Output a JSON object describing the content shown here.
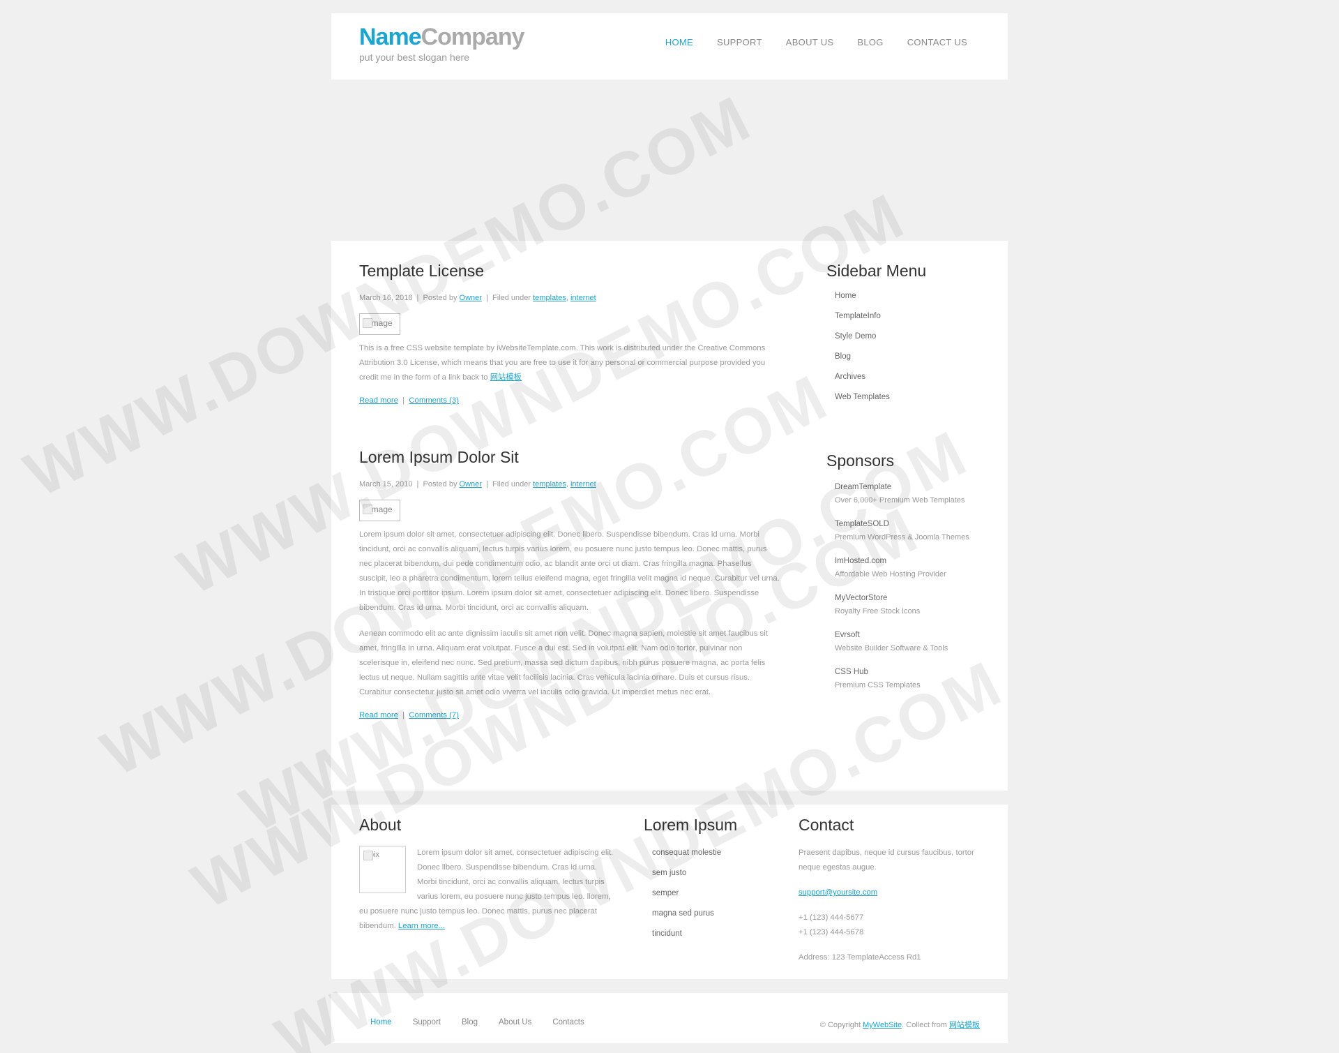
{
  "header": {
    "logo_name_1": "Name",
    "logo_name_2": "Company",
    "slogan": "put your best slogan here",
    "nav": [
      {
        "label": "HOME",
        "active": true
      },
      {
        "label": "SUPPORT"
      },
      {
        "label": "ABOUT US"
      },
      {
        "label": "BLOG"
      },
      {
        "label": "CONTACT US"
      }
    ]
  },
  "posts": [
    {
      "title": "Template License",
      "date": "March 16, 2018",
      "posted_by_label": "Posted by",
      "author": "Owner",
      "filed_label": "Filed under",
      "tags": [
        "templates",
        "internet"
      ],
      "image_alt": "image",
      "paragraphs": [
        "This is a free CSS website template by iWebsiteTemplate.com. This work is distributed under the Creative Commons Attribution 3.0 License, which means that you are free to use it for any personal or commercial purpose provided you credit me in the form of a link back to"
      ],
      "inline_link": "网站模板",
      "read_more": "Read more",
      "comments": "Comments (3)"
    },
    {
      "title": "Lorem Ipsum Dolor Sit",
      "date": "March 15, 2010",
      "posted_by_label": "Posted by",
      "author": "Owner",
      "filed_label": "Filed under",
      "tags": [
        "templates",
        "internet"
      ],
      "image_alt": "image",
      "paragraphs": [
        "Lorem ipsum dolor sit amet, consectetuer adipiscing elit. Donec libero. Suspendisse bibendum. Cras id urna. Morbi tincidunt, orci ac convallis aliquam, lectus turpis varius lorem, eu posuere nunc justo tempus leo. Donec mattis, purus nec placerat bibendum, dui pede condimentum odio, ac blandit ante orci ut diam. Cras fringilla magna. Phasellus suscipit, leo a pharetra condimentum, lorem tellus eleifend magna, eget fringilla velit magna id neque. Curabitur vel urna. In tristique orci porttitor ipsum. Lorem ipsum dolor sit amet, consectetuer adipiscing elit. Donec libero. Suspendisse bibendum. Cras id urna. Morbi tincidunt, orci ac convallis aliquam.",
        "Aenean commodo elit ac ante dignissim iaculis sit amet non velit. Donec magna sapien, molestie sit amet faucibus sit amet, fringilla in urna. Aliquam erat volutpat. Fusce a dui est. Sed in volutpat elit. Nam odio tortor, pulvinar non scelerisque in, eleifend nec nunc. Sed pretium, massa sed dictum dapibus, nibh purus posuere magna, ac porta felis lectus ut neque. Nullam sagittis ante vitae velit facilisis lacinia. Cras vehicula lacinia ornare. Duis et cursus risus. Curabitur consectetur justo sit amet odio viverra vel iaculis odio gravida. Ut imperdiet metus nec erat."
      ],
      "read_more": "Read more",
      "comments": "Comments (7)"
    }
  ],
  "sidebar": {
    "menu_title": "Sidebar Menu",
    "menu": [
      "Home",
      "TemplateInfo",
      "Style Demo",
      "Blog",
      "Archives",
      "Web Templates"
    ],
    "sponsors_title": "Sponsors",
    "sponsors": [
      {
        "name": "DreamTemplate",
        "desc": "Over 6,000+ Premium Web Templates"
      },
      {
        "name": "TemplateSOLD",
        "desc": "Premium WordPress & Joomla Themes"
      },
      {
        "name": "ImHosted.com",
        "desc": "Affordable Web Hosting Provider"
      },
      {
        "name": "MyVectorStore",
        "desc": "Royalty Free Stock Icons"
      },
      {
        "name": "Evrsoft",
        "desc": "Website Builder Software & Tools"
      },
      {
        "name": "CSS Hub",
        "desc": "Premium CSS Templates"
      }
    ]
  },
  "footer": {
    "about_title": "About",
    "about_pix_alt": "pix",
    "about_text": "Lorem ipsum dolor sit amet, consectetuer adipiscing elit. Donec libero. Suspendisse bibendum. Cras id urna. Morbi tincidunt, orci ac convallis aliquam, lectus turpis varius lorem, eu posuere nunc justo tempus leo. llorem, eu posuere nunc justo tempus leo. Donec mattis, purus nec placerat bibendum.",
    "about_link": "Learn more...",
    "lorem_title": "Lorem Ipsum",
    "lorem_items": [
      "consequat molestie",
      "sem justo",
      "semper",
      "magna sed purus",
      "tincidunt"
    ],
    "contact_title": "Contact",
    "contact_text": "Praesent dapibus, neque id cursus faucibus, tortor neque egestas augue.",
    "email": "support@yoursite.com",
    "phone1": "+1 (123) 444-5677",
    "phone2": "+1 (123) 444-5678",
    "address": "Address: 123 TemplateAccess Rd1"
  },
  "bottom": {
    "nav": [
      {
        "label": "Home",
        "active": true
      },
      {
        "label": "Support"
      },
      {
        "label": "Blog"
      },
      {
        "label": "About Us"
      },
      {
        "label": "Contacts"
      }
    ],
    "copyright_prefix": "© Copyright",
    "copyright_link": "MyWebSite",
    "collect_text": ". Collect from",
    "collect_link": "网站模板"
  },
  "watermark": "WWW.DOWNDEMO.COM",
  "colors": {
    "accent": "#1aa6d4",
    "background": "#f0f0f0"
  }
}
